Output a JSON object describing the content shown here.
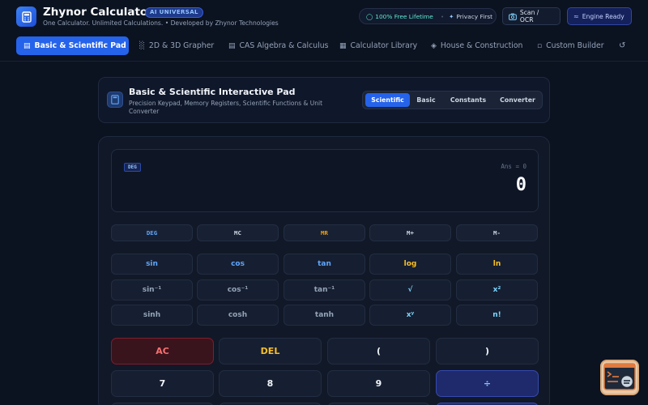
{
  "app": {
    "title": "Zhynor Calculator",
    "badge": "AI UNIVERSAL",
    "subtitle": "One Calculator. Unlimited Calculations. • Developed by Zhynor Technologies",
    "free_label": "100% Free Lifetime",
    "privacy_label": "Privacy First",
    "scan_label": "Scan / OCR",
    "engine_label": "Engine Ready"
  },
  "nav": {
    "items": [
      {
        "label": "Basic & Scientific Pad",
        "icon": "calculator-icon"
      },
      {
        "label": "2D & 3D Grapher",
        "icon": "chart-icon"
      },
      {
        "label": "CAS Algebra & Calculus",
        "icon": "document-icon"
      },
      {
        "label": "Calculator Library",
        "icon": "grid-icon"
      },
      {
        "label": "House & Construction",
        "icon": "layers-icon"
      },
      {
        "label": "Custom Builder",
        "icon": "file-icon"
      }
    ],
    "history_icon": "history-icon"
  },
  "panel": {
    "title": "Basic & Scientific Interactive Pad",
    "description": "Precision Keypad, Memory Registers, Scientific Functions & Unit Converter",
    "tabs": [
      "Scientific",
      "Basic",
      "Constants",
      "Converter"
    ],
    "active_tab": "Scientific"
  },
  "display": {
    "angle_mode": "DEG",
    "ans_line": "Ans = 0",
    "result": "0"
  },
  "memory_keys": [
    "DEG",
    "MC",
    "MR",
    "M+",
    "M-"
  ],
  "sci_keys": [
    [
      "sin",
      "cos",
      "tan",
      "log",
      "ln"
    ],
    [
      "sin⁻¹",
      "cos⁻¹",
      "tan⁻¹",
      "√",
      "x²"
    ],
    [
      "sinh",
      "cosh",
      "tanh",
      "xʸ",
      "n!"
    ]
  ],
  "main_keys": [
    [
      "AC",
      "DEL",
      "(",
      ")"
    ],
    [
      "7",
      "8",
      "9",
      "÷"
    ]
  ],
  "colors": {
    "accent": "#2563eb",
    "background": "#0b1220",
    "ac_key": "#f87171",
    "del_key": "#fbbf24"
  }
}
